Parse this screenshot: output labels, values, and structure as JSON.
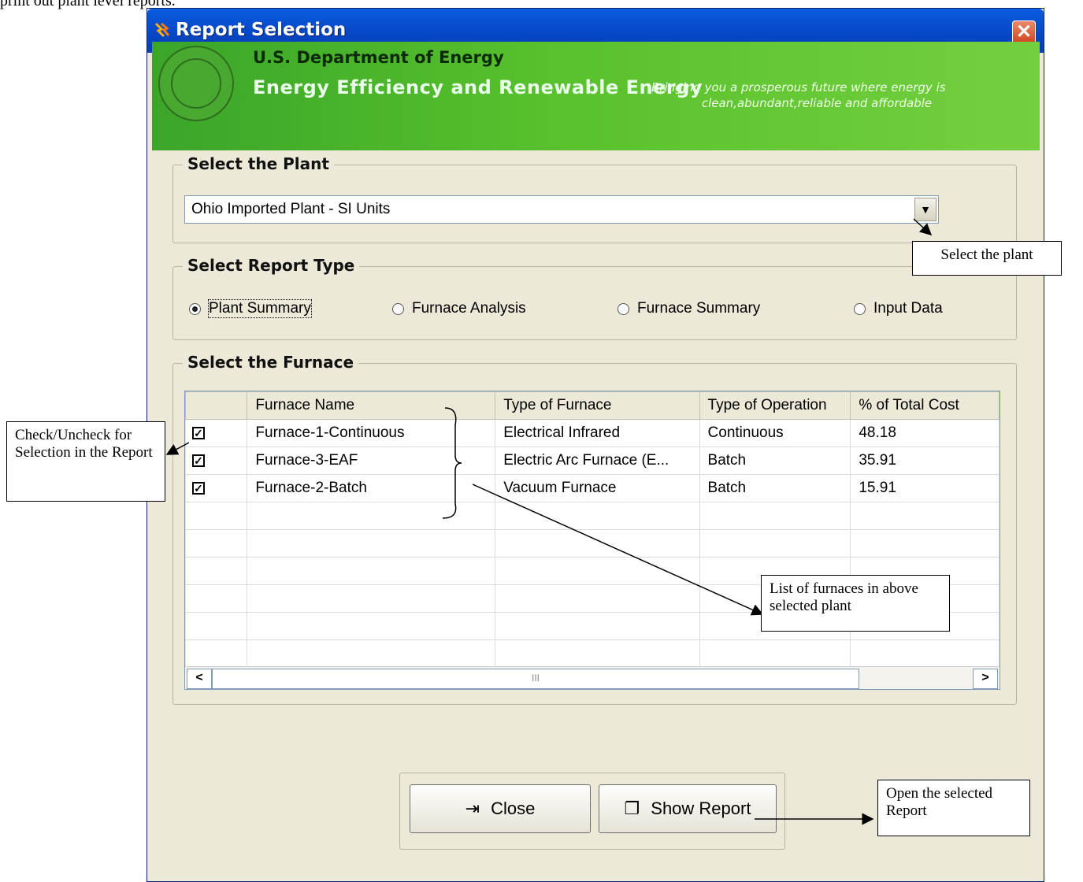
{
  "page": {
    "caption": "print out plant level reports."
  },
  "window": {
    "title": "Report Selection",
    "close_icon": "close-x-icon",
    "banner": {
      "line1": "U.S. Department of Energy",
      "line2": "Energy Efficiency and Renewable Energy",
      "tagline_1": "Bringing you a prosperous future where energy is",
      "tagline_2": "clean,abundant,reliable and affordable"
    }
  },
  "select_plant": {
    "label": "Select the Plant",
    "value": "Ohio Imported Plant - SI Units"
  },
  "report_type": {
    "label": "Select Report Type",
    "options": [
      "Plant Summary",
      "Furnace Analysis",
      "Furnace Summary",
      "Input Data"
    ],
    "selected": "Plant Summary"
  },
  "furnace": {
    "label": "Select the Furnace",
    "columns": [
      "Furnace Name",
      "Type of Furnace",
      "Type of Operation",
      "% of Total Cost"
    ],
    "rows": [
      {
        "checked": true,
        "name": "Furnace-1-Continuous",
        "type": "Electrical Infrared",
        "operation": "Continuous",
        "cost": "48.18"
      },
      {
        "checked": true,
        "name": "Furnace-3-EAF",
        "type": "Electric Arc Furnace (E...",
        "operation": "Batch",
        "cost": "35.91"
      },
      {
        "checked": true,
        "name": "Furnace-2-Batch",
        "type": "Vacuum Furnace",
        "operation": "Batch",
        "cost": "15.91"
      }
    ],
    "scroll_thumb": "III"
  },
  "buttons": {
    "close": "Close",
    "show_report": "Show Report"
  },
  "annotations": {
    "select_plant": "Select the plant",
    "check_uncheck": "Check/Uncheck for Selection in the Report",
    "list_furnaces": "List of furnaces in above selected plant",
    "open_report": "Open the selected Report"
  }
}
